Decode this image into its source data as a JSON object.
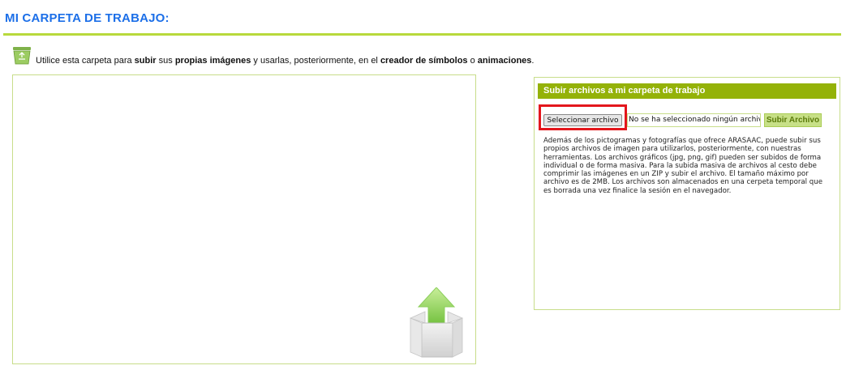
{
  "header": {
    "title": "MI CARPETA DE TRABAJO:"
  },
  "intro": {
    "part1": "Utilice esta carpeta para ",
    "bold1": "subir",
    "part2": " sus ",
    "bold2": "propias imágenes",
    "part3": " y usarlas, posteriormente, en el ",
    "bold3": "creador de símbolos",
    "part4": " o ",
    "bold4": "animaciones",
    "part5": "."
  },
  "upload": {
    "panel_title": "Subir archivos a mi carpeta de trabajo",
    "select_button": "Seleccionar archivo",
    "file_status": "No se ha seleccionado ningún archivo",
    "submit_button": "Subir Archivo",
    "description": "Además de los pictogramas y fotografías que ofrece ARASAAC, puede subir sus propios archivos de imagen para utilizarlos, posteriormente, con nuestras herramientas. Los archivos gráficos (jpg, png, gif) pueden ser subidos de forma individual o de forma masiva. Para la subida masiva de archivos al cesto debe comprimir las imágenes en un ZIP y subir el archivo. El tamaño máximo por archivo es de 2MB. Los archivos son almacenados en una cerpeta temporal que es borrada una vez finalice la sesión en el navegador."
  },
  "icons": {
    "basket": "recycle-basket-icon",
    "upload_box": "upload-box-icon"
  },
  "colors": {
    "title": "#1c6fe8",
    "accent": "#94b208",
    "rule": "#b8d93c",
    "highlight": "#e3161c"
  }
}
